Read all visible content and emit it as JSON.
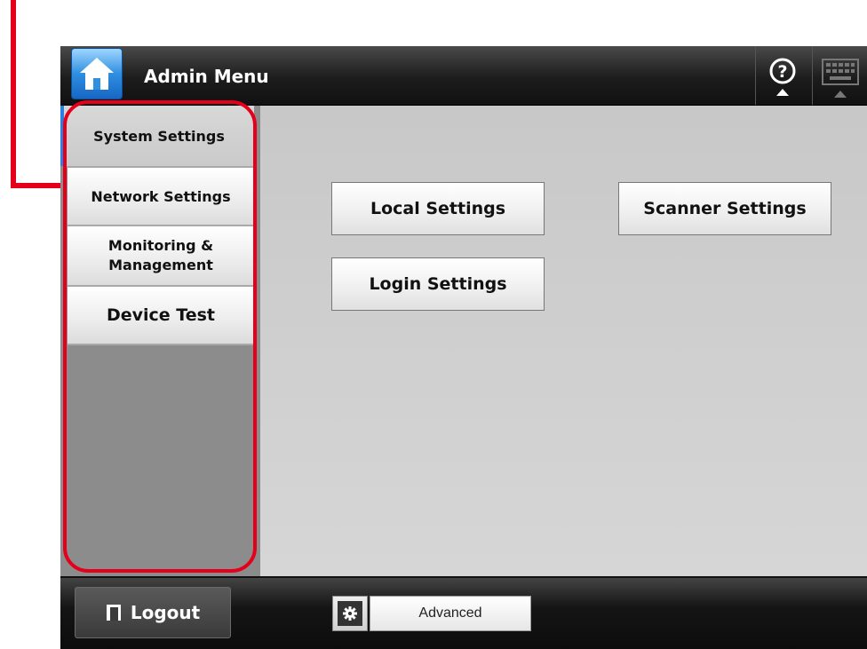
{
  "header": {
    "title": "Admin Menu",
    "home_icon": "home-icon",
    "help_icon": "help-icon",
    "keyboard_icon": "keyboard-icon"
  },
  "sidebar": {
    "tabs": [
      {
        "label": "System Settings"
      },
      {
        "label": "Network Settings"
      },
      {
        "label": "Monitoring &\nManagement"
      },
      {
        "label": "Device Test"
      }
    ]
  },
  "main": {
    "buttons": {
      "local": "Local Settings",
      "login": "Login Settings",
      "scanner": "Scanner Settings"
    }
  },
  "footer": {
    "logout_label": "Logout",
    "advanced_label": "Advanced"
  },
  "colors": {
    "accent": "#2b7fe0",
    "highlight": "#e4001b"
  }
}
